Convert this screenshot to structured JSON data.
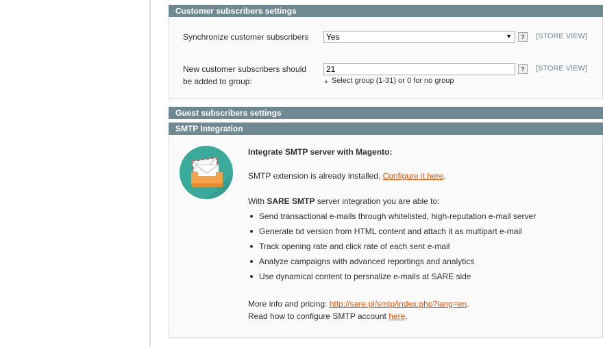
{
  "customer_section": {
    "title": "Customer subscribers settings",
    "sync_label": "Synchronize customer subscribers",
    "sync_value": "Yes",
    "sync_scope": "[STORE VIEW]",
    "group_label": "New customer subscribers should be added to group:",
    "group_value": "21",
    "group_scope": "[STORE VIEW]",
    "group_note": "Select group (1-31) or 0 for no group",
    "help_glyph": "?"
  },
  "guest_section": {
    "title": "Guest subscribers settings"
  },
  "smtp_section": {
    "title": "SMTP Integration",
    "icon": "envelope-icon",
    "heading": "Integrate SMTP server with Magento:",
    "installed_text": "SMTP extension is already installed.",
    "configure_link": "Configure it here",
    "intro_prefix": "With ",
    "intro_bold": "SARE SMTP",
    "intro_suffix": " server integration you are able to:",
    "features": [
      "Send transactional e-mails through whitelisted, high-reputation e-mail server",
      "Generate txt version from HTML content and attach it as multipart e-mail",
      "Track opening rate and click rate of each sent e-mail",
      "Analyze campaigns with advanced reportings and analytics",
      "Use dynamical content to persnalize e-mails at SARE side"
    ],
    "more_info_prefix": "More info and pricing: ",
    "more_info_link": "http://sare.pl/smtp/index.php?lang=en",
    "read_prefix": "Read how to configure SMTP account ",
    "read_link": "here"
  },
  "colors": {
    "header": "#6f8992",
    "link": "#eb5202",
    "icon_circle": "#3aab9b",
    "icon_box": "#f4a24a"
  }
}
